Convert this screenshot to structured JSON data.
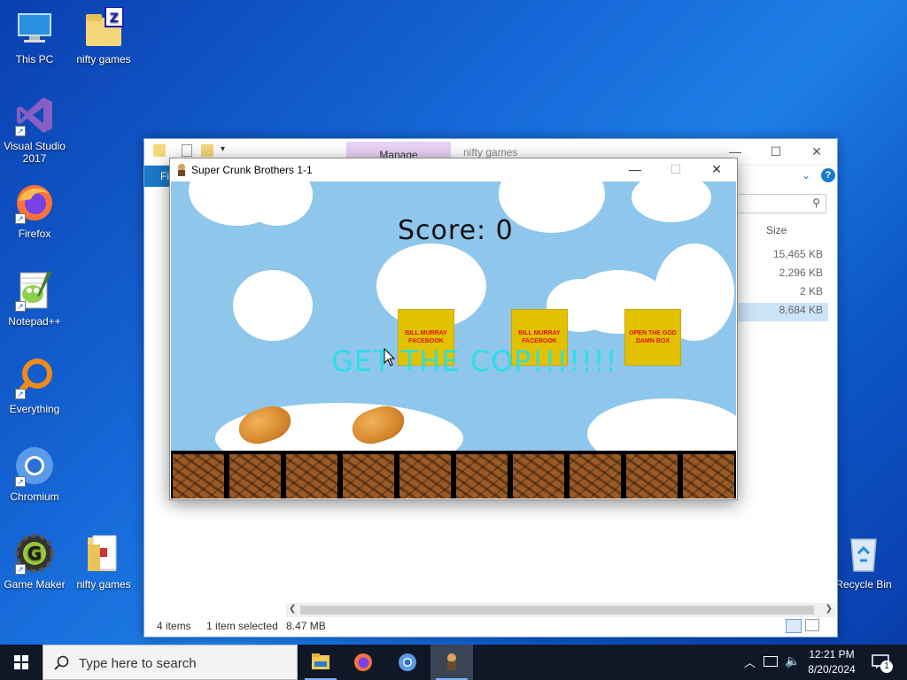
{
  "desktop": {
    "icons": [
      {
        "label": "This PC",
        "icon": "computer-icon"
      },
      {
        "label": "nifty games",
        "icon": "zip-folder-icon"
      },
      {
        "label": "Visual Studio 2017",
        "icon": "visual-studio-icon"
      },
      {
        "label": "Firefox",
        "icon": "firefox-icon"
      },
      {
        "label": "Notepad++",
        "icon": "notepadpp-icon"
      },
      {
        "label": "Everything",
        "icon": "everything-icon"
      },
      {
        "label": "Chromium",
        "icon": "chromium-icon"
      },
      {
        "label": "Game Maker",
        "icon": "game-maker-icon"
      },
      {
        "label": "nifty games",
        "icon": "folder-icon"
      },
      {
        "label": "Recycle Bin",
        "icon": "recycle-bin-icon"
      }
    ]
  },
  "explorer": {
    "manage_tab": "Manage",
    "title": "nifty games",
    "file_tab": "Fi",
    "size_header": "Size",
    "sizes": [
      "15,465 KB",
      "2,296 KB",
      "2 KB",
      "8,684 KB"
    ],
    "status": {
      "items": "4 items",
      "selected": "1 item selected",
      "size": "8.47 MB"
    }
  },
  "game": {
    "title": "Super Crunk Brothers 1-1",
    "score_text": "Score: 0",
    "boxes": [
      "BILL MURRAY FACEBOOK",
      "BILL MURRAY FACEBOOK",
      "OPEN THE GOD DAMN BOX"
    ],
    "banner": "GET THE COP!!!!!!!"
  },
  "taskbar": {
    "search_placeholder": "Type here to search",
    "time": "12:21 PM",
    "date": "8/20/2024",
    "notification_count": "1"
  },
  "colors": {
    "accent": "#1979ca",
    "box": "#e2c200",
    "box_text": "#e01010",
    "sky": "#8ec6ec",
    "banner": "#24e0ea"
  }
}
